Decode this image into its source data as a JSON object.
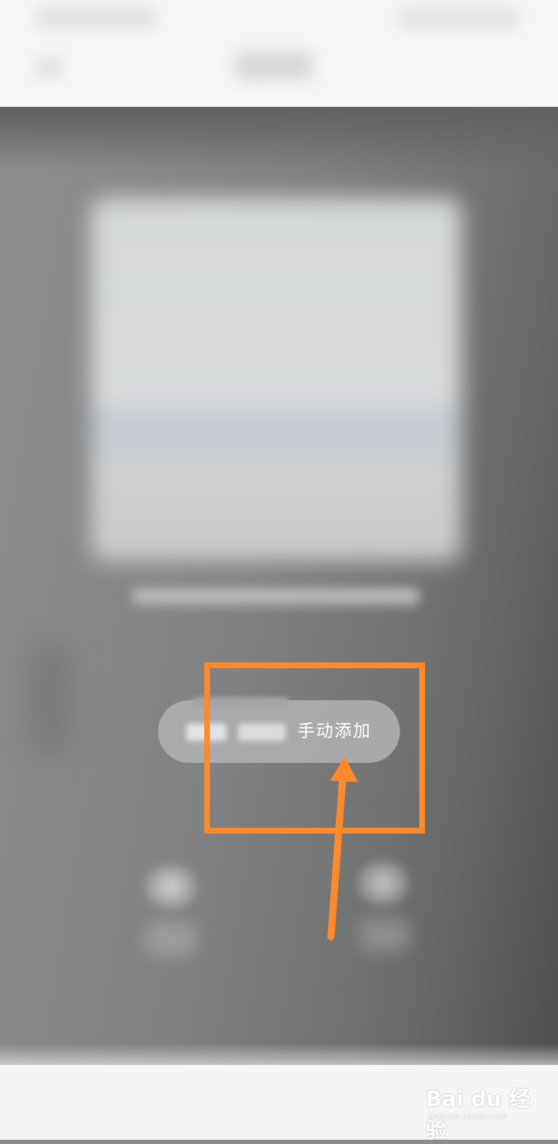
{
  "mode_switcher": {
    "manual_add_label": "手动添加"
  },
  "annotation": {
    "highlight_color": "#ff8a2c",
    "arrow_color": "#ff8a2c"
  },
  "watermark": {
    "logo_text": "Bai du 经验",
    "sub_text": "jingyan.baidu.com"
  },
  "colors": {
    "header_background": "#f6f6f6",
    "pill_background": "#afb0b1",
    "label_text": "#ffffff"
  }
}
